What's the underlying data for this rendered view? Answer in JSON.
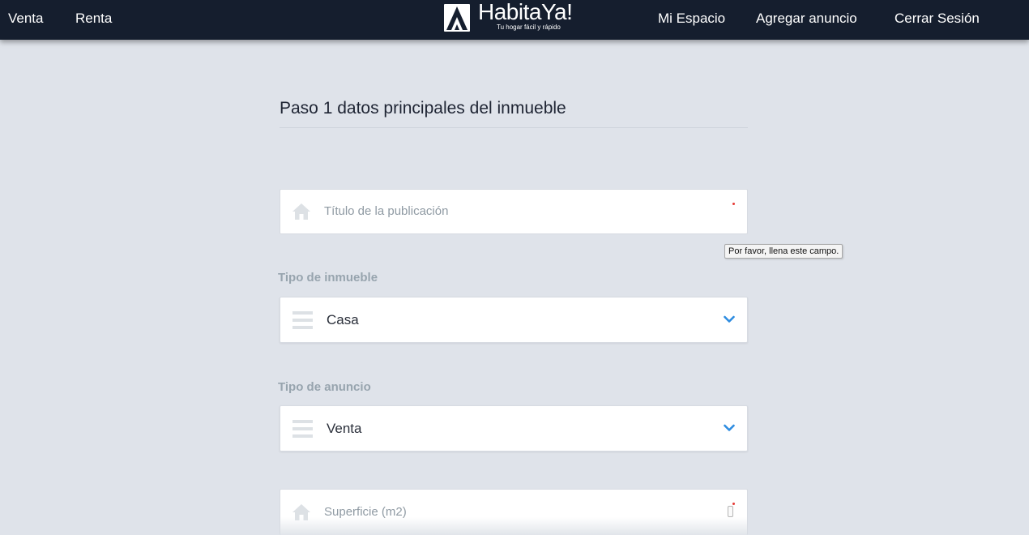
{
  "nav": {
    "left": [
      "Venta",
      "Renta"
    ],
    "right": [
      "Mi Espacio",
      "Agregar anuncio",
      "Cerrar Sesión"
    ]
  },
  "logo": {
    "name": "HabitaYa!",
    "tagline": "Tu hogar fácil y rápido"
  },
  "form": {
    "step_title": "Paso 1 datos principales del inmueble",
    "title_field": {
      "placeholder": "Título de la publicación",
      "icon": "home-icon",
      "required": true
    },
    "tooltip": "Por favor, llena este campo.",
    "property_type": {
      "label": "Tipo de inmueble",
      "value": "Casa",
      "icon": "list-icon"
    },
    "listing_type": {
      "label": "Tipo de anuncio",
      "value": "Venta",
      "icon": "list-icon"
    },
    "area_field": {
      "placeholder": "Superficie (m2)",
      "icon": "home-icon",
      "required": true
    }
  },
  "colors": {
    "navbar": "#151e2e",
    "background": "#dfe3ea",
    "accent": "#2d8ce0",
    "required": "#e53935"
  }
}
